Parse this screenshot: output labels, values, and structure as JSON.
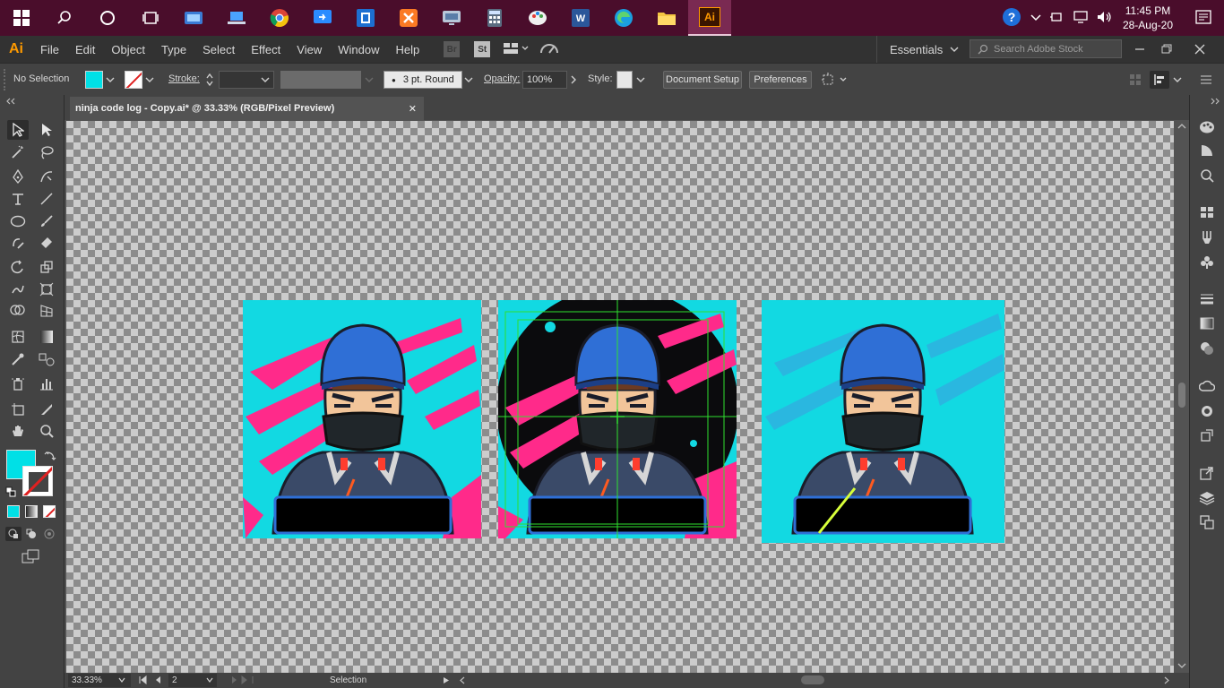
{
  "taskbar": {
    "apps": [
      "windows-start",
      "search",
      "cortana",
      "task-view",
      "app-1",
      "app-2",
      "chrome",
      "app-3",
      "app-4",
      "xampp",
      "app-5",
      "calculator",
      "paint",
      "word",
      "edge",
      "file-explorer",
      "illustrator"
    ],
    "ai_label": "Ai",
    "time": "11:45 PM",
    "date": "28-Aug-20"
  },
  "menubar": {
    "logo": "Ai",
    "items": [
      "File",
      "Edit",
      "Object",
      "Type",
      "Select",
      "Effect",
      "View",
      "Window",
      "Help"
    ],
    "workspace": "Essentials",
    "stock_placeholder": "Search Adobe Stock"
  },
  "control": {
    "selection": "No Selection",
    "stroke_label": "Stroke:",
    "brush": "3 pt. Round",
    "opacity_label": "Opacity:",
    "opacity_value": "100%",
    "style_label": "Style:",
    "doc_setup": "Document Setup",
    "preferences": "Preferences"
  },
  "colors": {
    "fill": "#00e0e6",
    "accent": "#ff9a00",
    "taskbar": "#4a0d2b",
    "artwork_pink": "#ff2a8a"
  },
  "document": {
    "tab_title": "ninja code log - Copy.ai* @ 33.33% (RGB/Pixel Preview)"
  },
  "status": {
    "zoom": "33.33%",
    "artboard": "2",
    "tool": "Selection"
  }
}
